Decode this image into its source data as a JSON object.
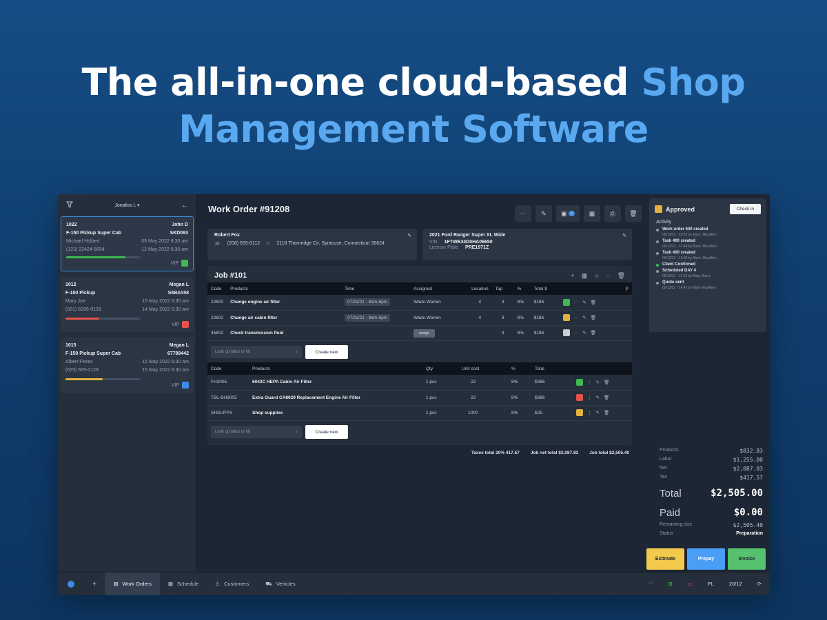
{
  "headline": {
    "line1_white": "The all-in-one cloud-based ",
    "line1_accent": "Shop",
    "line2_accent": "Management Software"
  },
  "sidebar": {
    "user": "Jonaliss L",
    "cards": [
      {
        "id": "1022",
        "assignee": "John D",
        "vehicle": "F-150 Pickup Super Cab",
        "plate": "SKD093",
        "customer": "Michael Holbert",
        "date1": "09 May 2022 6:30 am",
        "phone": "(123) 22424-5654",
        "date2": "12 May 2022 6:30 am",
        "progress": 0.8,
        "progress_color": "#3fb950",
        "vip": "VIP",
        "status_color": "#3fb950"
      },
      {
        "id": "1012",
        "assignee": "Megan L",
        "vehicle": "F-100 Pickup",
        "plate": "S8B4A58",
        "customer": "Mary Joe",
        "date1": "15 May 2022 6:30 am",
        "phone": "(331) 6336-0133",
        "date2": "14 May 2022 6:30 am",
        "progress": 0.45,
        "progress_color": "#e5534b",
        "vip": "VIP",
        "status_color": "#e5534b"
      },
      {
        "id": "1015",
        "assignee": "Megan L",
        "vehicle": "F-150 Pickup Super Cab",
        "plate": "67789442",
        "customer": "Albert Flores",
        "date1": "15 May 2022 6:30 am",
        "phone": "(629) 555-0129",
        "date2": "15 May 2022 6:30 am",
        "progress": 0.5,
        "progress_color": "#e3b341",
        "vip": "VIP",
        "status_color": "#3d8de6"
      }
    ]
  },
  "work_order": {
    "title": "Work Order #91208",
    "badge": "2",
    "customer": {
      "name": "Robert Fox",
      "phone": "(208) 555-0112",
      "address": "2118 Thornridge Cir. Syracuse, Connecticut 35624"
    },
    "vehicle": {
      "name": "2021 Ford Ranger Super XL Wide",
      "vin_label": "VIN",
      "vin": "1FTWE34D0HA06650",
      "plate_label": "License Plate",
      "plate": "PRE1971Z"
    }
  },
  "job": {
    "title": "Job #101",
    "task_headers": [
      "Code",
      "Products",
      "Time",
      "Assigned",
      "Location",
      "Tap",
      "%",
      "Total $"
    ],
    "tasks": [
      {
        "code": "22600",
        "name": "Change engine air filter",
        "time": "07/11/21 - 8am-6pm",
        "assigned": "Wade Warren",
        "location": "4",
        "tap": "3",
        "pct": "8%",
        "total": "$186",
        "status_color": "#3fb950"
      },
      {
        "code": "22602",
        "name": "Change air cabin filter",
        "time": "07/11/21 - 9am-6pm",
        "assigned": "Wade Warren",
        "location": "4",
        "tap": "3",
        "pct": "8%",
        "total": "$186",
        "status_color": "#e3b341"
      },
      {
        "code": "45802",
        "name": "Check transmission fluid",
        "time": "",
        "assigned": "assign",
        "location": "",
        "tap": "3",
        "pct": "8%",
        "total": "$186",
        "status_color": "#c9ced6"
      }
    ],
    "product_headers": [
      "Code",
      "Products",
      "Qty",
      "Unit cost",
      "%",
      "Total"
    ],
    "products": [
      {
        "code": "FH3005",
        "name": "6043C HEPA Cabin Air Filter",
        "qty": "1 pcs",
        "unit": "22",
        "pct": "8%",
        "total": "$386",
        "status_color": "#3fb950"
      },
      {
        "code": "TBL-BH3005",
        "name": "Extra Guard CA8029 Replacement Engine Air Filter",
        "qty": "1 pcs",
        "unit": "22",
        "pct": "8%",
        "total": "$386",
        "status_color": "#e5534b"
      },
      {
        "code": "SHSUPPS",
        "name": "Shop supplies",
        "qty": "1 pcs",
        "unit": "1000",
        "pct": "8%",
        "total": "$25",
        "status_color": "#e3b341"
      }
    ],
    "lookup_placeholder": "Look up labor or kit",
    "create_label": "Create new",
    "totals": {
      "taxes": "Taxes total 20% 417.57",
      "net": "Job net total $2,087.83",
      "job": "Job total $2,505.40"
    }
  },
  "right_panel": {
    "status": "Approved",
    "checkin_label": "Check in",
    "activity_title": "Activity",
    "activity": [
      {
        "title": "Work order 640 created",
        "sub": "09/12/21 - 10:52 by Mark, MacAllen",
        "green": false
      },
      {
        "title": "Task 400 created",
        "sub": "09/12/21 - 12:44 by Mark, MacAllen",
        "green": false
      },
      {
        "title": "Task 400 created",
        "sub": "09/12/21 - 12:38 by Mark, MacAllen",
        "green": false
      },
      {
        "title": "Client Confirmed",
        "sub": "",
        "green": true
      },
      {
        "title": "Scheduled DAY 4",
        "sub": "09/12/21 - 12:22 by Mary, Barry",
        "green": false
      },
      {
        "title": "Quote sent",
        "sub": "09/12/21 - 14:42 by Mark MacAllen",
        "green": false
      }
    ],
    "summary": [
      {
        "k": "Products",
        "v": "$832.83"
      },
      {
        "k": "Labor",
        "v": "$1,255.00"
      },
      {
        "k": "Net",
        "v": "$2,087.83"
      },
      {
        "k": "Tax",
        "v": "$417.57"
      }
    ],
    "total_label": "Total",
    "total_value": "$2,505.00",
    "paid_label": "Paid",
    "paid_value": "$0.00",
    "remaining_label": "Remaining due",
    "remaining_value": "$2,505.40",
    "status_label": "Status",
    "status_value": "Preparation",
    "buttons": [
      {
        "label": "Estimate",
        "color": "#f2c94c"
      },
      {
        "label": "Prepay",
        "color": "#4a9ef5"
      },
      {
        "label": "Invoice",
        "color": "#56c16f"
      }
    ]
  },
  "bottom_nav": {
    "items": [
      "Work Orders",
      "Schedule",
      "Customers",
      "Vehicles"
    ],
    "lang": "PL",
    "date": "20/12"
  }
}
